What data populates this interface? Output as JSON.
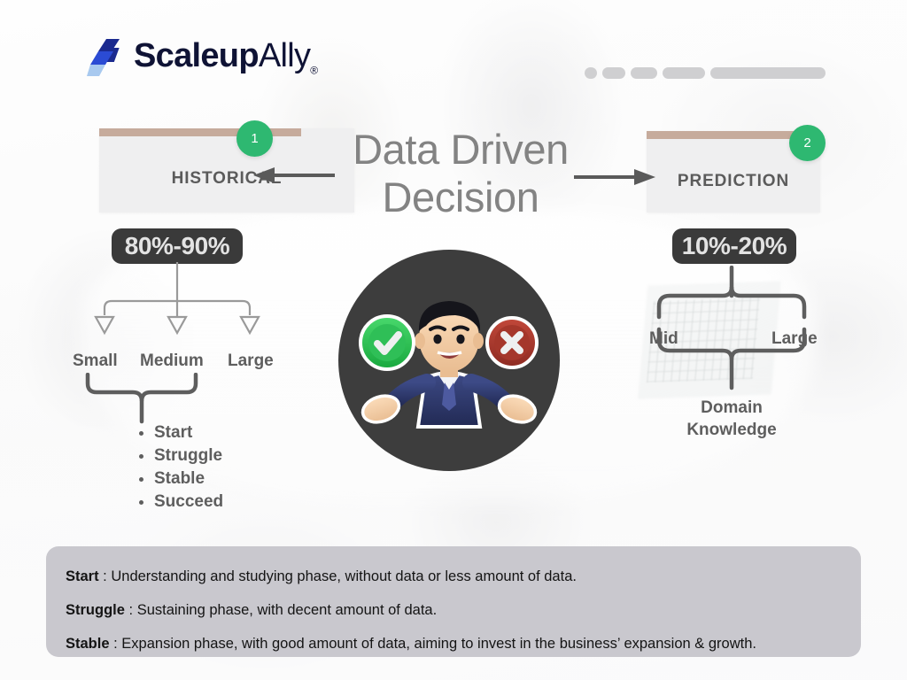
{
  "brand": {
    "name_bold": "Scaleup",
    "name_light": "Ally",
    "registered_mark": "®",
    "logo_icon": "scaleupally-chevron-logo",
    "color_dark": "#0f1335",
    "color_blue_dark": "#1b2a8f",
    "color_blue_mid": "#2b4bd4",
    "color_blue_light": "#a8c9ef"
  },
  "progress_bars": {
    "name": "progress-indicator-bars",
    "widths": [
      14,
      26,
      30,
      48,
      130
    ],
    "color": "#cfcfd1"
  },
  "cards": {
    "historical": {
      "label": "HISTORICAL",
      "badge": "1",
      "badge_color": "#2eb871",
      "accent_color": "#c6ab9c"
    },
    "prediction": {
      "label": "PREDICTION",
      "badge": "2",
      "badge_color": "#2eb871",
      "accent_color": "#c6ab9c"
    }
  },
  "title": {
    "line1": "Data Driven",
    "line2": "Decision",
    "color": "#838383"
  },
  "arrows": {
    "left_arrow": "arrow-pointing-left",
    "right_arrow": "arrow-pointing-right",
    "color": "#5a5a5a"
  },
  "left_branch": {
    "percentage": "80%-90%",
    "tiers": [
      "Small",
      "Medium",
      "Large"
    ],
    "phases": [
      "Start",
      "Struggle",
      "Stable",
      "Succeed"
    ]
  },
  "right_branch": {
    "percentage": "10%-20%",
    "tiers": [
      "Mid",
      "Large"
    ],
    "caption_line1": "Domain",
    "caption_line2": "Knowledge"
  },
  "hero": {
    "name": "businessman-weighing-options-illustration",
    "circle_color": "#3d3d3d",
    "approve_icon": "green-check-circle-icon",
    "reject_icon": "red-x-circle-icon",
    "approve_color": "#2fbf57",
    "reject_color": "#b5392e"
  },
  "legend": [
    {
      "term": "Start",
      "separator": " : ",
      "description": "Understanding and studying phase, without data or less amount of data."
    },
    {
      "term": "Struggle",
      "separator": " : ",
      "description": "Sustaining phase, with decent amount of data."
    },
    {
      "term": "Stable",
      "separator": " : ",
      "description": "Expansion phase, with good amount of data, aiming to invest in the business’ expansion & growth."
    }
  ]
}
